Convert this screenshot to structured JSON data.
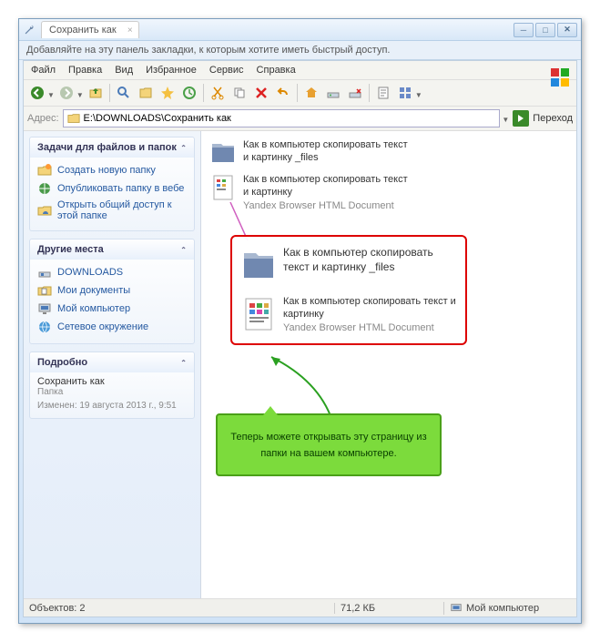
{
  "titlebar": {
    "tab_title": "Сохранить как"
  },
  "bookmark_hint": "Добавляйте на эту панель закладки, к которым хотите иметь быстрый доступ.",
  "menu": {
    "file": "Файл",
    "edit": "Правка",
    "view": "Вид",
    "favorites": "Избранное",
    "tools": "Сервис",
    "help": "Справка"
  },
  "addressbar": {
    "label": "Адрес:",
    "path": "E:\\DOWNLOADS\\Сохранить как",
    "go": "Переход"
  },
  "sidebar": {
    "tasks": {
      "title": "Задачи для файлов и папок",
      "new_folder": "Создать новую папку",
      "publish": "Опубликовать папку в вебе",
      "share": "Открыть общий доступ к этой папке"
    },
    "other": {
      "title": "Другие места",
      "downloads": "DOWNLOADS",
      "docs": "Мои документы",
      "computer": "Мой компьютер",
      "network": "Сетевое окружение"
    },
    "details": {
      "title": "Подробно",
      "name": "Сохранить как",
      "type": "Папка",
      "modified": "Изменен: 19 августа 2013 г., 9:51"
    }
  },
  "files": {
    "folder_name": "Как в компьютер скопировать текст и картинку _files",
    "html_name": "Как в компьютер скопировать текст и картинку",
    "html_type": "Yandex Browser HTML Document"
  },
  "callout": "Теперь можете открывать эту страницу из папки на вашем компьютере.",
  "statusbar": {
    "objects": "Объектов: 2",
    "size": "71,2 КБ",
    "location": "Мой компьютер"
  }
}
